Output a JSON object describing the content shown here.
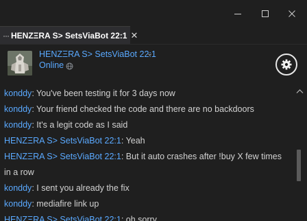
{
  "window": {
    "minimize_icon": "minimize-icon",
    "maximize_icon": "maximize-icon",
    "close_icon": "close-icon"
  },
  "tab": {
    "more_label": "···",
    "title": "HENZΞRA S> SetsViaBot 22:1",
    "close_label": "✕"
  },
  "header": {
    "contact_name": "HENZΞRA S> SetsViaBot 22:1",
    "chevron": "⌄",
    "status": "Online",
    "settings_icon": "gear-icon"
  },
  "colors": {
    "accent": "#5aa9ff",
    "background": "#1f1f1f",
    "text": "#d2d2d2"
  },
  "messages": [
    {
      "sender": "konddy",
      "text": "You've been testing it for 3 days now"
    },
    {
      "sender": "konddy",
      "text": "Your friend checked the code and there are no backdoors"
    },
    {
      "sender": "konddy",
      "text": "It's a legit code as I said"
    },
    {
      "sender": "HENZΞRA S> SetsViaBot 22:1",
      "text": "Yeah"
    },
    {
      "sender": "HENZΞRA S> SetsViaBot 22:1",
      "text": "But it auto crashes after !buy X few times in a row"
    },
    {
      "sender": "konddy",
      "text": "I sent you already the fix"
    },
    {
      "sender": "konddy",
      "text": "mediafire link up"
    },
    {
      "sender": "HENZΞRA S> SetsViaBot 22:1",
      "text": "oh sorry"
    }
  ]
}
